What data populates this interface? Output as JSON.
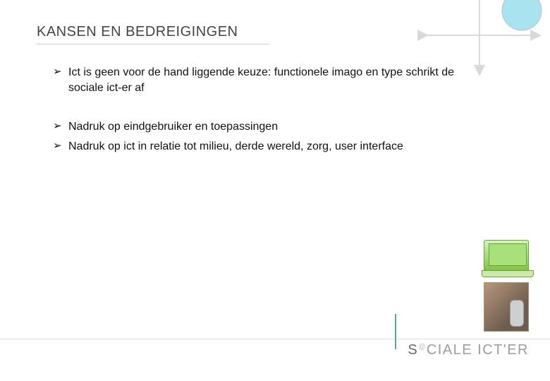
{
  "title": "KANSEN EN BEDREIGINGEN",
  "bullets": {
    "group1": [
      "Ict is geen voor de hand liggende keuze: functionele imago en type schrikt de sociale ict-er af"
    ],
    "group2": [
      "Nadruk op eindgebruiker en toepassingen",
      "Nadruk op ict in relatie tot milieu, derde wereld, zorg, user interface"
    ]
  },
  "logo": {
    "part1": "S",
    "part2": "CIALE ICT'ER",
    "o_inner": "O"
  },
  "icons": {
    "bullet_arrow": "➢",
    "decoration": "cross-arrows-with-circle",
    "image1": "green-laptop",
    "image2": "exoskeleton-leg"
  }
}
